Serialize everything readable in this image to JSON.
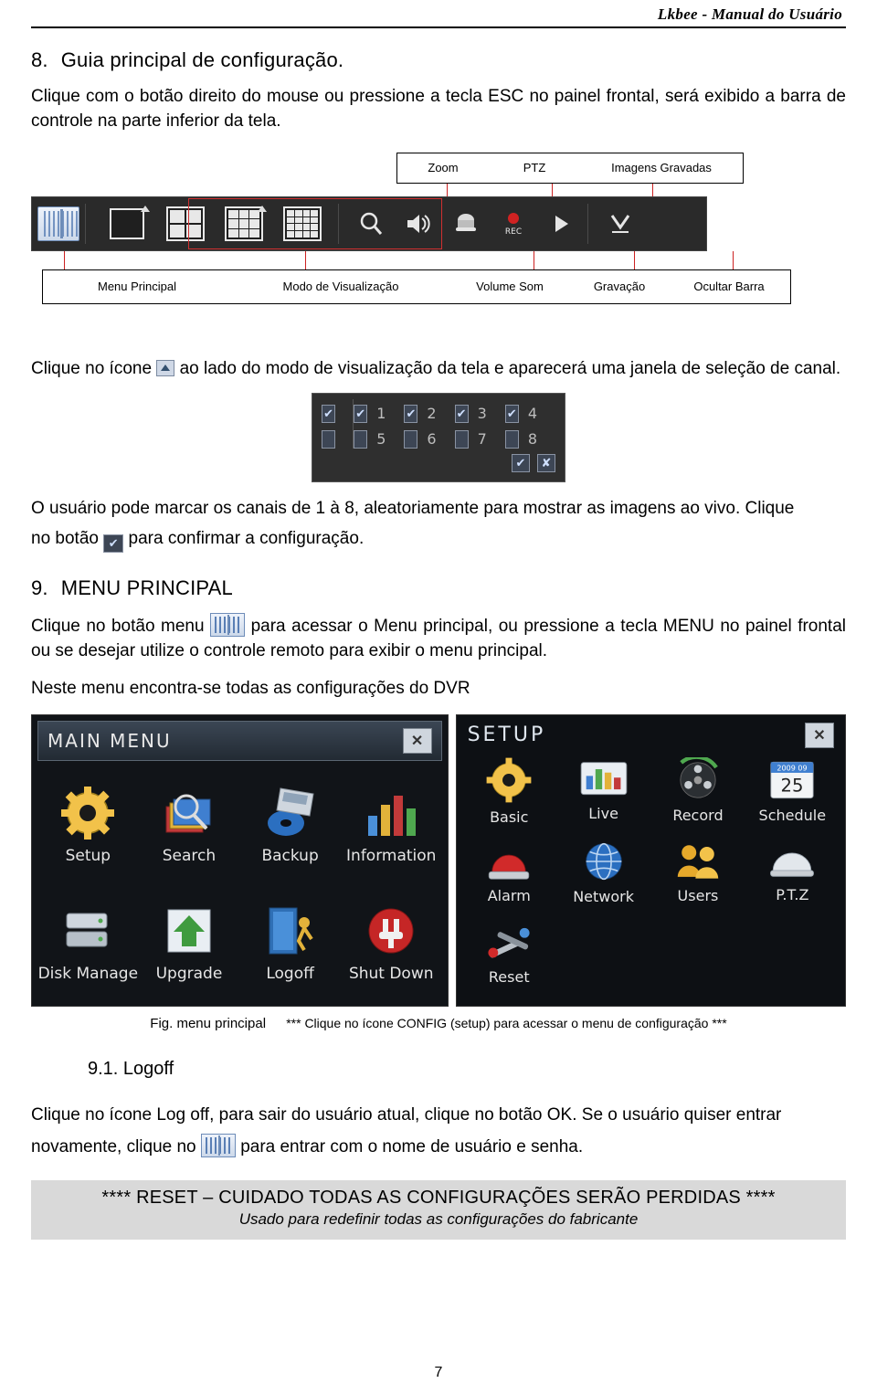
{
  "header": {
    "title": "Lkbee - Manual do Usuário"
  },
  "section8": {
    "number": "8.",
    "title": "Guia principal de configuração.",
    "intro": "Clique com o botão direito do mouse ou pressione a tecla ESC no painel frontal, será exibido a barra de controle na parte inferior da tela."
  },
  "toolbar": {
    "top_labels": [
      "Zoom",
      "PTZ",
      "Imagens Gravadas"
    ],
    "bottom_labels": [
      "Menu Principal",
      "Modo de Visualização",
      "Volume Som",
      "Gravação",
      "Ocultar Barra"
    ],
    "icons": [
      "main-menu-icon",
      "single-view-icon",
      "quad-view-icon",
      "nine-view-icon",
      "sixteen-view-icon",
      "zoom-search-icon",
      "volume-icon",
      "ptz-icon",
      "rec-icon",
      "playback-icon",
      "hide-bar-icon"
    ]
  },
  "channel_text": {
    "before_icon": "Clique no ícone",
    "after_icon": "ao lado do modo de visualização da tela e aparecerá uma janela de seleção de canal."
  },
  "channel_select": {
    "row1": [
      "1",
      "2",
      "3",
      "4"
    ],
    "row2": [
      "5",
      "6",
      "7",
      "8"
    ],
    "confirm": "✔",
    "cancel": "✘",
    "master_checked": true
  },
  "confirm_text": {
    "line1": "O usuário pode marcar os canais de 1 à 8, aleatoriamente para mostrar as imagens ao vivo. Clique",
    "line2_before": "no botão",
    "line2_after": "para confirmar a configuração."
  },
  "section9": {
    "number": "9.",
    "title": "MENU PRINCIPAL",
    "p1_before": "Clique no botão menu",
    "p1_after": "para acessar o Menu principal, ou pressione a tecla    MENU no painel frontal ou se desejar utilize o controle remoto para exibir o menu principal.",
    "p2": "Neste menu encontra-se todas as configurações do DVR"
  },
  "main_menu": {
    "title": "MAIN MENU",
    "close": "✕",
    "items": [
      {
        "label": "Setup",
        "icon": "gear-icon"
      },
      {
        "label": "Search",
        "icon": "magnifier-book-icon"
      },
      {
        "label": "Backup",
        "icon": "disc-backup-icon"
      },
      {
        "label": "Information",
        "icon": "bar-chart-icon"
      },
      {
        "label": "Disk Manage",
        "icon": "hard-disk-icon"
      },
      {
        "label": "Upgrade",
        "icon": "upload-arrow-icon"
      },
      {
        "label": "Logoff",
        "icon": "door-exit-icon"
      },
      {
        "label": "Shut Down",
        "icon": "power-plug-icon"
      }
    ]
  },
  "setup_menu": {
    "title": "SETUP",
    "close": "✕",
    "items": [
      {
        "label": "Basic",
        "icon": "gear-icon"
      },
      {
        "label": "Live",
        "icon": "monitor-bars-icon"
      },
      {
        "label": "Record",
        "icon": "film-reel-icon"
      },
      {
        "label": "Schedule",
        "icon": "calendar-icon",
        "calendar_year": "2009  09",
        "calendar_day": "25"
      },
      {
        "label": "Alarm",
        "icon": "alarm-siren-icon"
      },
      {
        "label": "Network",
        "icon": "globe-icon"
      },
      {
        "label": "Users",
        "icon": "users-icon"
      },
      {
        "label": "P.T.Z",
        "icon": "dome-camera-icon"
      },
      {
        "label": "Reset",
        "icon": "tools-icon"
      }
    ]
  },
  "figure_caption": {
    "label": "Fig. menu principal",
    "note": "*** Clique no ícone CONFIG (setup) para acessar o menu de configuração ***"
  },
  "section91": {
    "number": "9.1.",
    "title": "Logoff",
    "p_line1": "Clique no ícone Log off, para sair do usuário atual, clique no botão OK. Se o usuário quiser entrar",
    "p_line2_before": "novamente, clique no",
    "p_line2_after": "para entrar com o nome de usuário e senha."
  },
  "reset_note": {
    "line1": "****   RESET  – CUIDADO TODAS AS CONFIGURAÇÕES SERÃO PERDIDAS   ****",
    "line2": "Usado para redefinir todas as configurações do fabricante"
  },
  "footer": {
    "page_number": "7"
  }
}
